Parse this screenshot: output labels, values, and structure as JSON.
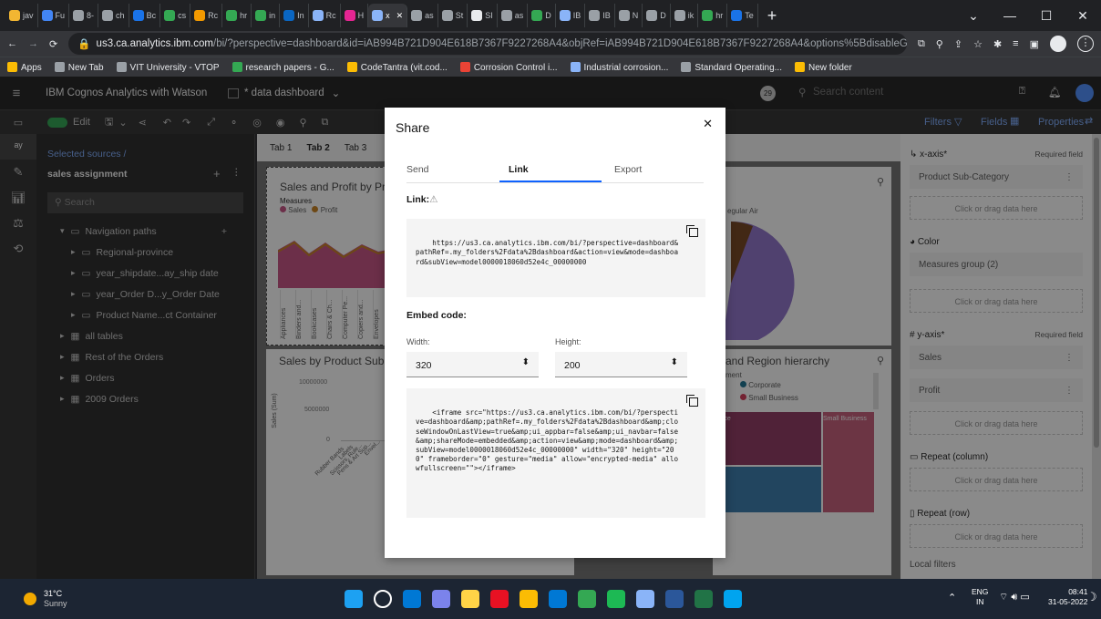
{
  "browser": {
    "tabs": [
      {
        "label": "jav",
        "color": "#f2b632"
      },
      {
        "label": "Fu",
        "color": "#4285f4"
      },
      {
        "label": "8-",
        "color": "#9aa0a6"
      },
      {
        "label": "ch",
        "color": "#9aa0a6"
      },
      {
        "label": "Bc",
        "color": "#1a73e8"
      },
      {
        "label": "cs",
        "color": "#34a853"
      },
      {
        "label": "Rc",
        "color": "#f29900"
      },
      {
        "label": "hr",
        "color": "#34a853"
      },
      {
        "label": "in",
        "color": "#34a853"
      },
      {
        "label": "In",
        "color": "#0a66c2"
      },
      {
        "label": "Rc",
        "color": "#8ab4f8"
      },
      {
        "label": "H",
        "color": "#e52592"
      },
      {
        "label": "x",
        "color": "#8ab4f8",
        "active": true
      },
      {
        "label": "as",
        "color": "#9aa0a6"
      },
      {
        "label": "St",
        "color": "#9aa0a6"
      },
      {
        "label": "SI",
        "color": "#e8eaed"
      },
      {
        "label": "as",
        "color": "#9aa0a6"
      },
      {
        "label": "D",
        "color": "#34a853"
      },
      {
        "label": "IB",
        "color": "#8ab4f8"
      },
      {
        "label": "IB",
        "color": "#9aa0a6"
      },
      {
        "label": "N",
        "color": "#9aa0a6"
      },
      {
        "label": "D",
        "color": "#9aa0a6"
      },
      {
        "label": "ik",
        "color": "#9aa0a6"
      },
      {
        "label": "hr",
        "color": "#34a853"
      },
      {
        "label": "Te",
        "color": "#1a73e8"
      }
    ],
    "url_domain": "us3.ca.analytics.ibm.com",
    "url_path": "/bi/?perspective=dashboard&id=iAB994B721D904E618B7367F9227268A4&objRef=iAB994B721D904E618B7367F9227268A4&options%5BdisableGlas...",
    "bookmarks": [
      {
        "label": "Apps",
        "color": "#fbbc04"
      },
      {
        "label": "New Tab",
        "color": "#9aa0a6"
      },
      {
        "label": "VIT University - VTOP",
        "color": "#9aa0a6"
      },
      {
        "label": "research papers - G...",
        "color": "#34a853"
      },
      {
        "label": "CodeTantra (vit.cod...",
        "color": "#fbbc04"
      },
      {
        "label": "Corrosion Control i...",
        "color": "#ea4335"
      },
      {
        "label": "Industrial corrosion...",
        "color": "#8ab4f8"
      },
      {
        "label": "Standard Operating...",
        "color": "#9aa0a6"
      },
      {
        "label": "New folder",
        "color": "#fbbc04"
      }
    ]
  },
  "app": {
    "title": "IBM Cognos Analytics with Watson",
    "dashboard": "* data dashboard",
    "notif_count": "29",
    "search_placeholder": "Search content",
    "edit_label": "Edit",
    "filters": "Filters",
    "fields": "Fields",
    "properties": "Properties"
  },
  "sources": {
    "breadcrumb": "Selected sources /",
    "name": "sales assignment",
    "search": "Search",
    "items": [
      {
        "label": "Navigation paths",
        "indent": 1,
        "open": true
      },
      {
        "label": "Regional-province",
        "indent": 2
      },
      {
        "label": "year_shipdate...ay_ship date",
        "indent": 2
      },
      {
        "label": "year_Order D...y_Order Date",
        "indent": 2
      },
      {
        "label": "Product Name...ct Container",
        "indent": 2
      },
      {
        "label": "all tables",
        "indent": 1,
        "table": true
      },
      {
        "label": "Rest of the Orders",
        "indent": 1,
        "table": true
      },
      {
        "label": "Orders",
        "indent": 1,
        "table": true
      },
      {
        "label": "2009 Orders",
        "indent": 1,
        "table": true
      }
    ]
  },
  "canvas": {
    "tabs": [
      "Tab 1",
      "Tab 2",
      "Tab 3"
    ],
    "viz1_title": "Sales and Profit by Pro",
    "viz1_legend_title": "Measures",
    "viz1_legend": [
      "Sales",
      "Profit"
    ],
    "viz1_categories": [
      "Appliances",
      "Binders and...",
      "Bookcases",
      "Chairs & Ch...",
      "Computer Pe...",
      "Copiers and...",
      "Envelopes"
    ],
    "viz2_title": "Sales by Product Sub-C",
    "viz2_ylabel": "Sales (Sum)",
    "viz2_ticks": [
      "10000000",
      "5000000",
      "0"
    ],
    "viz2_categories": [
      "Rubber Bands",
      "Labels",
      "Scissors, Rule...",
      "Pens & Art Sup...",
      "Envel..."
    ],
    "viz3_label": "egular Air",
    "viz4_title": "and Region hierarchy",
    "viz4_legend_title": "ment",
    "viz4_legend": [
      "Corporate",
      "Small Business"
    ],
    "viz4_labels": [
      "ffice",
      "Small Business"
    ]
  },
  "properties": {
    "xaxis": "x-axis*",
    "required": "Required field",
    "xfield": "Product Sub-Category",
    "drop": "Click or drag data here",
    "color": "Color",
    "colorfield": "Measures group (2)",
    "yaxis": "y-axis*",
    "yfields": [
      "Sales",
      "Profit"
    ],
    "repeat_col": "Repeat (column)",
    "repeat_row": "Repeat (row)",
    "local_filters": "Local filters"
  },
  "share": {
    "title": "Share",
    "tabs": [
      "Send",
      "Link",
      "Export"
    ],
    "active_tab": "Link",
    "link_label": "Link:",
    "link": "https://us3.ca.analytics.ibm.com/bi/?perspective=dashboard&pathRef=.my_folders%2Fdata%2Bdashboard&action=view&mode=dashboard&subView=model0000018060d52e4c_00000000",
    "embed_label": "Embed code:",
    "width_label": "Width:",
    "height_label": "Height:",
    "width": "320",
    "height": "200",
    "embed": "<iframe src=\"https://us3.ca.analytics.ibm.com/bi/?perspective=dashboard&amp;pathRef=.my_folders%2Fdata%2Bdashboard&amp;closeWindowOnLastView=true&amp;ui_appbar=false&amp;ui_navbar=false&amp;shareMode=embedded&amp;action=view&amp;mode=dashboard&amp;subView=model0000018060d52e4c_00000000\" width=\"320\" height=\"200\" frameborder=\"0\" gesture=\"media\" allow=\"encrypted-media\" allowfullscreen=\"\"></iframe>",
    "colors": {
      "accent": "#0f62fe",
      "text": "#161616"
    }
  },
  "taskbar": {
    "temp": "31°C",
    "weather": "Sunny",
    "lang": "ENG",
    "region": "IN",
    "time": "08:41",
    "date": "31-05-2022",
    "apps": [
      "#1da1f2",
      "#ffffff",
      "#0078d4",
      "#7b83eb",
      "#ffd447",
      "#e81123",
      "#fbbc04",
      "#0078d4",
      "#34a853",
      "#1db954",
      "#8ab4f8",
      "#2b579a",
      "#217346",
      "#00a4ef"
    ]
  }
}
